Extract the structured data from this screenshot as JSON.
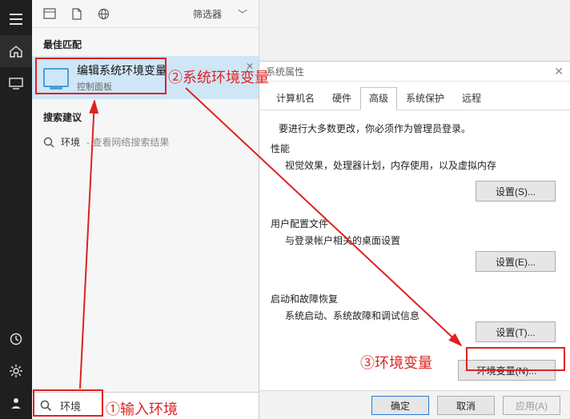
{
  "taskbar": {
    "items": [
      "menu",
      "home",
      "monitor"
    ],
    "bottom": [
      "clock",
      "gear",
      "person"
    ]
  },
  "startpane": {
    "filter_label": "筛选器",
    "best_match_label": "最佳匹配",
    "result": {
      "title": "编辑系统环境变量",
      "subtitle": "控制面板"
    },
    "suggest_label": "搜索建议",
    "suggest_item": "环境",
    "suggest_hint": "- 查看网络搜索结果"
  },
  "search": {
    "value": "环境"
  },
  "dialog": {
    "title": "系统属性",
    "tabs": [
      "计算机名",
      "硬件",
      "高级",
      "系统保护",
      "远程"
    ],
    "active_tab": 2,
    "admin_note": "要进行大多数更改，你必须作为管理员登录。",
    "perf": {
      "name": "性能",
      "desc": "视觉效果，处理器计划，内存使用，以及虚拟内存",
      "btn": "设置(S)..."
    },
    "profile": {
      "name": "用户配置文件",
      "desc": "与登录帐户相关的桌面设置",
      "btn": "设置(E)..."
    },
    "startup": {
      "name": "启动和故障恢复",
      "desc": "系统启动、系统故障和调试信息",
      "btn": "设置(T)..."
    },
    "env_btn": "环境变量(N)...",
    "footer": {
      "ok": "确定",
      "cancel": "取消",
      "apply": "应用(A)"
    }
  },
  "annotations": {
    "a1": "①输入环境",
    "a2": "②系统环境变量",
    "a3": "③环境变量"
  }
}
